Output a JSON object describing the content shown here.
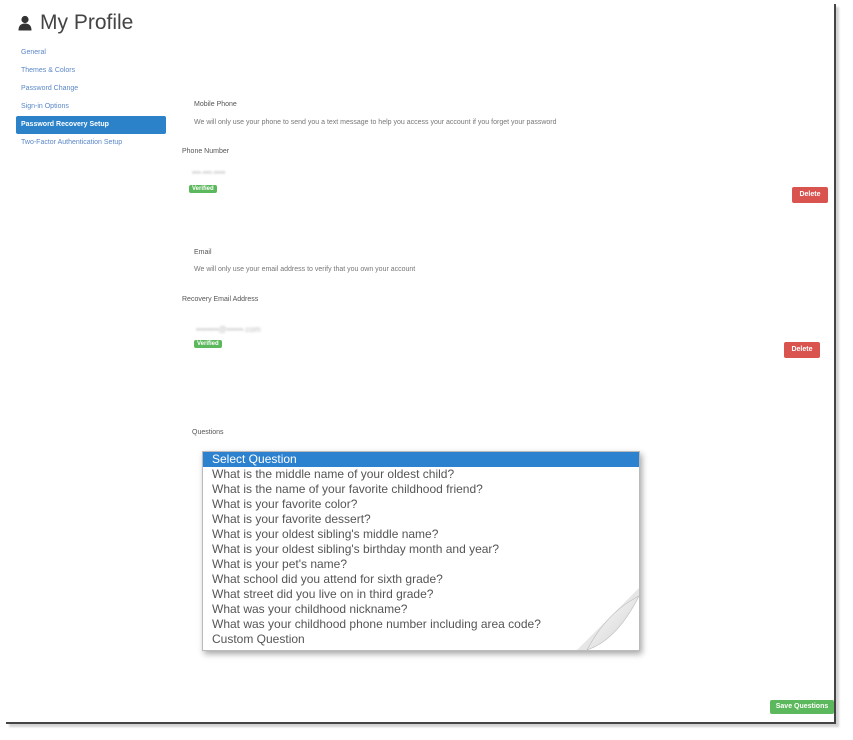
{
  "header": {
    "title": "My Profile",
    "icon": "user-icon"
  },
  "sidebar": {
    "items": [
      {
        "label": "General",
        "active": false
      },
      {
        "label": "Themes & Colors",
        "active": false
      },
      {
        "label": "Password Change",
        "active": false
      },
      {
        "label": "Sign-in Options",
        "active": false
      },
      {
        "label": "Password Recovery Setup",
        "active": true
      },
      {
        "label": "Two-Factor Authentication Setup",
        "active": false
      }
    ]
  },
  "mobile": {
    "heading": "Mobile Phone",
    "description": "We will only use your phone to send you a text message to help you access your account if you forget your password",
    "field_label": "Phone Number",
    "value": "•••-•••-••••",
    "status": "Verified",
    "delete_label": "Delete"
  },
  "email": {
    "heading": "Email",
    "description": "We will only use your email address to verify that you own your account",
    "field_label": "Recovery Email Address",
    "value": "••••••••@••••••.com",
    "status": "Verified",
    "delete_label": "Delete"
  },
  "questions": {
    "heading": "Questions",
    "options": [
      "Select Question",
      "What is the middle name of your oldest child?",
      "What is the name of your favorite childhood friend?",
      "What is your favorite color?",
      "What is your favorite dessert?",
      "What is your oldest sibling's middle name?",
      "What is your oldest sibling's birthday month and year?",
      "What is your pet's name?",
      "What school did you attend for sixth grade?",
      "What street did you live on in third grade?",
      "What was your childhood nickname?",
      "What was your childhood phone number including area code?",
      "Custom Question"
    ],
    "selected": "Select Question"
  },
  "footer": {
    "save_label": "Save Questions"
  },
  "colors": {
    "accent": "#2b82c9",
    "verified": "#5cb85c",
    "delete": "#d9534f"
  }
}
